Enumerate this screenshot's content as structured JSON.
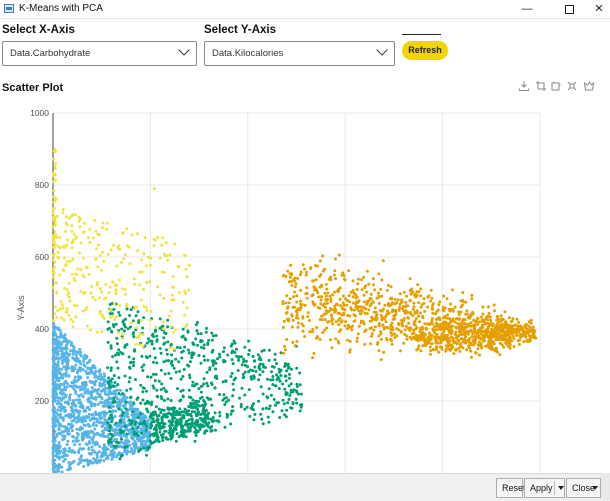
{
  "window": {
    "title": "K-Means with PCA",
    "minimize_glyph": "—",
    "close_glyph": "✕"
  },
  "controls": {
    "x_axis_label": "Select X-Axis",
    "x_axis_value": "Data.Carbohydrate",
    "y_axis_label": "Select Y-Axis",
    "y_axis_value": "Data.Kilocalories",
    "refresh_label": "Refresh"
  },
  "toolbar_icons": [
    "download-icon",
    "zoom-select-icon",
    "zoom-reset-icon",
    "box-select-icon",
    "lasso-icon"
  ],
  "chart_title": "Scatter Plot",
  "chart_data": {
    "type": "scatter",
    "ylabel": "Y-Axis",
    "xlabel": "",
    "yticks": [
      200,
      400,
      600,
      800,
      1000
    ],
    "ylim": [
      0,
      1000
    ],
    "xlim": [
      0,
      250
    ],
    "grid": true,
    "clusters": [
      {
        "color": "#56b4e9",
        "approx_points": 1400,
        "x_range": [
          0,
          50
        ],
        "y_range": [
          0,
          420
        ],
        "centroid": [
          15,
          170
        ]
      },
      {
        "color": "#009e73",
        "approx_points": 700,
        "x_range": [
          30,
          130
        ],
        "y_range": [
          0,
          500
        ],
        "centroid": [
          65,
          260
        ]
      },
      {
        "color": "#f0e442",
        "approx_points": 300,
        "x_range": [
          0,
          70
        ],
        "y_range": [
          400,
          900
        ],
        "centroid": [
          20,
          600
        ]
      },
      {
        "color": "#e69f00",
        "approx_points": 1000,
        "x_range": [
          110,
          250
        ],
        "y_range": [
          150,
          620
        ],
        "centroid": [
          180,
          390
        ]
      }
    ]
  },
  "bottom_bar": {
    "reset_label": "Reset",
    "apply_label": "Apply",
    "close_label": "Close"
  }
}
